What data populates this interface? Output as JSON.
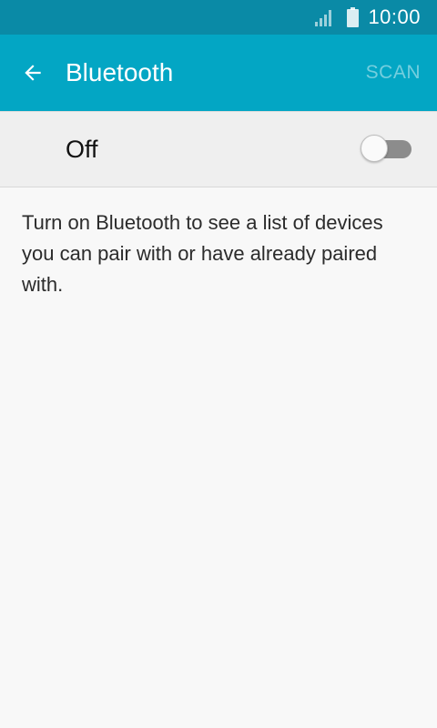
{
  "status_bar": {
    "time": "10:00",
    "signal_icon": "signal-icon",
    "battery_icon": "battery-icon"
  },
  "app_bar": {
    "title": "Bluetooth",
    "back_icon": "arrow-back-icon",
    "scan_label": "SCAN"
  },
  "toggle": {
    "label": "Off",
    "state": "off"
  },
  "content": {
    "description": "Turn on Bluetooth to see a list of devices you can pair with or have already paired with."
  },
  "colors": {
    "status_bar": "#0a8aa6",
    "app_bar": "#03a6c4",
    "background": "#f8f8f8",
    "toggle_row": "#efefef"
  }
}
